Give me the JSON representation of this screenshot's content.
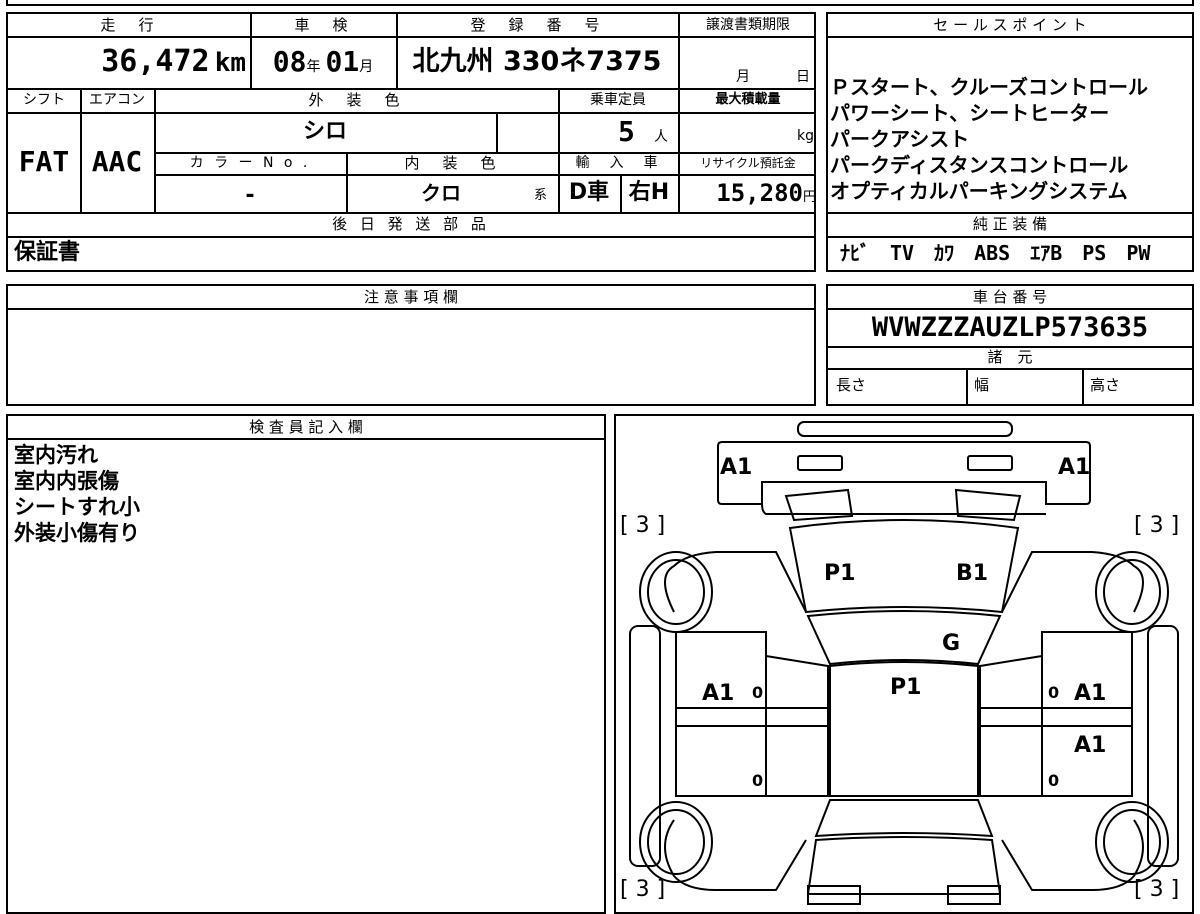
{
  "labels": {
    "mileage": "走　行",
    "shaken": "車　検",
    "registration": "登　録　番　号",
    "transfer_deadline": "譲渡書類期限",
    "sales_points": "セ ー ル ス ポ イ ン ト",
    "shift": "シフト",
    "aircon": "エアコン",
    "exterior_color": "外　装　色",
    "capacity": "乗車定員",
    "max_load": "最大積載量",
    "color_no": "カ ラ ー N o .",
    "interior_color": "内　装　色",
    "import": "輸　入　車",
    "recycle": "リサイクル預託金",
    "later_parts": "後 日 発 送 部 品",
    "genuine_equipment": "純 正 装 備",
    "notes": "注 意 事 項 欄",
    "chassis_no": "車 台 番 号",
    "specs": "諸　元",
    "length": "長さ",
    "width": "幅",
    "height": "高さ",
    "inspector": "検 査 員 記 入 欄"
  },
  "values": {
    "mileage": "36,472",
    "mileage_unit": "km",
    "shaken_year": "08",
    "shaken_year_unit": "年",
    "shaken_month": "01",
    "shaken_month_unit": "月",
    "registration": "北九州 330ネ7375",
    "deadline_month": "月",
    "deadline_day": "日",
    "shift": "FAT",
    "aircon": "AAC",
    "exterior_color": "シロ",
    "capacity": "5",
    "capacity_unit": "人",
    "max_load_unit": "kg",
    "color_no": "-",
    "interior_color": "クロ",
    "interior_suffix": "系",
    "import_type": "D車",
    "handle": "右H",
    "recycle": "15,280",
    "recycle_unit": "円",
    "later_parts": "保証書",
    "genuine_equipment": "ﾅﾋﾞ　TV　ｶﾜ　ABS　ｴｱB　PS　PW",
    "chassis_no": "WVWZZZAUZLP573635"
  },
  "sales_points": [
    "Ｐスタート、クルーズコントロール",
    "パワーシート、シートヒーター",
    "パークアシスト",
    "パークディスタンスコントロール",
    "オプティカルパーキングシステム"
  ],
  "inspector_notes": [
    "室内汚れ",
    "室内内張傷",
    "シートすれ小",
    "外装小傷有り"
  ],
  "diagram": {
    "marks": {
      "front_left": "A1",
      "front_right": "A1",
      "hood_left": "P1",
      "hood_right": "B1",
      "windshield": "G",
      "roof": "P1",
      "left_front_door": "A1",
      "right_front_door": "A1",
      "right_rear_door": "A1",
      "bracket_tl": "[ 3 ]",
      "bracket_tr": "[ 3 ]",
      "bracket_bl": "[ 3 ]",
      "bracket_br": "[ 3 ]",
      "zero_lf": "0",
      "zero_rf": "0",
      "zero_lr": "0",
      "zero_rr": "0"
    }
  }
}
